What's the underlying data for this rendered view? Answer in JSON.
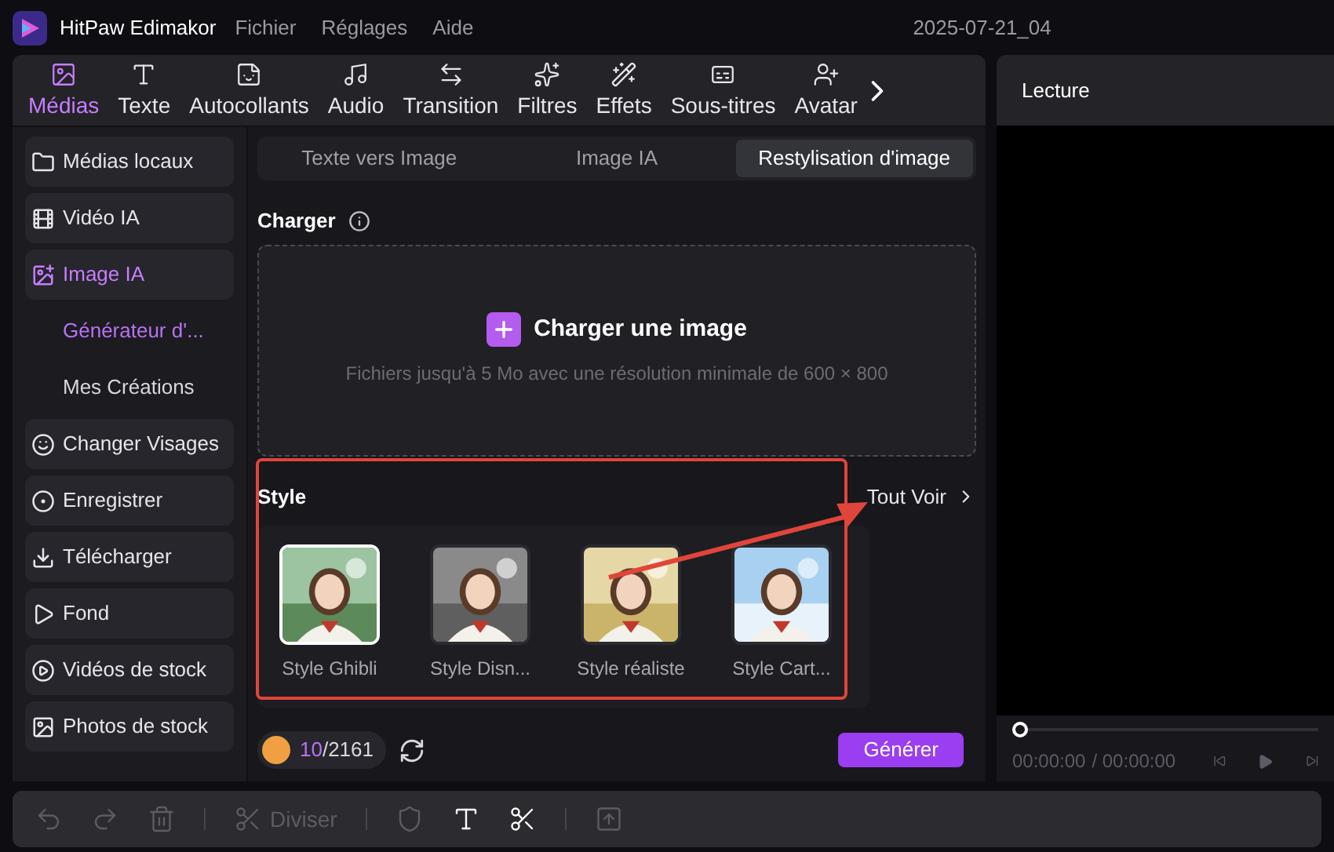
{
  "title_bar": {
    "app_name": "HitPaw Edimakor",
    "menu": [
      "Fichier",
      "Réglages",
      "Aide"
    ],
    "project": "2025-07-21_04"
  },
  "media_tabs": [
    {
      "label": "Médias",
      "selected": true
    },
    {
      "label": "Texte",
      "selected": false
    },
    {
      "label": "Autocollants",
      "selected": false
    },
    {
      "label": "Audio",
      "selected": false
    },
    {
      "label": "Transition",
      "selected": false
    },
    {
      "label": "Filtres",
      "selected": false
    },
    {
      "label": "Effets",
      "selected": false
    },
    {
      "label": "Sous-titres",
      "selected": false
    },
    {
      "label": "Avatar",
      "selected": false
    }
  ],
  "sidebar": {
    "items": [
      {
        "kind": "item",
        "label": "Médias locaux",
        "selected": false
      },
      {
        "kind": "item",
        "label": "Vidéo IA",
        "selected": false
      },
      {
        "kind": "item",
        "label": "Image IA",
        "selected": true
      },
      {
        "kind": "sub",
        "label": "Générateur d'...",
        "selected": true
      },
      {
        "kind": "sub",
        "label": "Mes Créations",
        "selected": false
      },
      {
        "kind": "item",
        "label": "Changer Visages",
        "selected": false
      },
      {
        "kind": "item",
        "label": "Enregistrer",
        "selected": false
      },
      {
        "kind": "item",
        "label": "Télécharger",
        "selected": false
      },
      {
        "kind": "item",
        "label": "Fond",
        "selected": false
      },
      {
        "kind": "item",
        "label": "Vidéos de stock",
        "selected": false
      },
      {
        "kind": "item",
        "label": "Photos de stock",
        "selected": false
      }
    ]
  },
  "mode_tabs": [
    {
      "label": "Texte vers Image",
      "selected": false
    },
    {
      "label": "Image IA",
      "selected": false
    },
    {
      "label": "Restylisation d'image",
      "selected": true
    }
  ],
  "upload": {
    "heading": "Charger",
    "button": "Charger une image",
    "hint": "Fichiers jusqu'à 5 Mo avec une résolution minimale de 600 × 800"
  },
  "style": {
    "heading": "Style",
    "see_all": "Tout Voir",
    "items": [
      {
        "label": "Style Ghibli",
        "selected": true
      },
      {
        "label": "Style Disn...",
        "selected": false
      },
      {
        "label": "Style réaliste",
        "selected": false
      },
      {
        "label": "Style Cart...",
        "selected": false
      }
    ]
  },
  "credits": {
    "used": "10",
    "total": "/2161"
  },
  "generate_button": "Générer",
  "preview": {
    "title": "Lecture",
    "level": 0,
    "time_current": "00:00:00",
    "time_total": "/ 00:00:00"
  },
  "toolbar": [
    {
      "kind": "undo",
      "disabled": true
    },
    {
      "kind": "redo",
      "disabled": true
    },
    {
      "kind": "delete",
      "disabled": true
    },
    {
      "kind": "split",
      "label": "Diviser",
      "disabled": true
    },
    {
      "kind": "shield",
      "disabled": true
    },
    {
      "kind": "text",
      "disabled": false
    },
    {
      "kind": "cut",
      "disabled": false
    },
    {
      "kind": "export",
      "disabled": true
    }
  ]
}
